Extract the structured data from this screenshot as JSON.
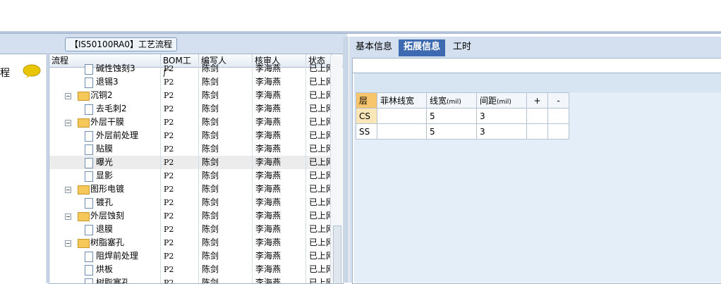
{
  "left_nav": {
    "label": "程"
  },
  "panel_title": "【IS50100RA0】工艺流程",
  "grid": {
    "columns": [
      "流程",
      "BOM工厂",
      "编写人",
      "核审人",
      "状态"
    ],
    "rows": [
      {
        "name": "碱性蚀刻3",
        "type": "doc",
        "indent": 1,
        "bom": "P2",
        "writer": "陈剑",
        "reviewer": "李海燕",
        "status": "已上网"
      },
      {
        "name": "退锡3",
        "type": "doc",
        "indent": 1,
        "bom": "P2",
        "writer": "陈剑",
        "reviewer": "李海燕",
        "status": "已上网"
      },
      {
        "name": "沉铜2",
        "type": "folder",
        "indent": 0,
        "bom": "P2",
        "writer": "陈剑",
        "reviewer": "李海燕",
        "status": "已上网"
      },
      {
        "name": "去毛刺2",
        "type": "doc",
        "indent": 1,
        "bom": "P2",
        "writer": "陈剑",
        "reviewer": "李海燕",
        "status": "已上网"
      },
      {
        "name": "外层干膜",
        "type": "folder",
        "indent": 0,
        "bom": "P2",
        "writer": "陈剑",
        "reviewer": "李海燕",
        "status": "已上网"
      },
      {
        "name": "外层前处理",
        "type": "doc",
        "indent": 1,
        "bom": "P2",
        "writer": "陈剑",
        "reviewer": "李海燕",
        "status": "已上网"
      },
      {
        "name": "贴膜",
        "type": "doc",
        "indent": 1,
        "bom": "P2",
        "writer": "陈剑",
        "reviewer": "李海燕",
        "status": "已上网"
      },
      {
        "name": "曝光",
        "type": "doc",
        "indent": 1,
        "bom": "P2",
        "writer": "陈剑",
        "reviewer": "李海燕",
        "status": "已上网",
        "selected": true
      },
      {
        "name": "显影",
        "type": "doc",
        "indent": 1,
        "bom": "P2",
        "writer": "陈剑",
        "reviewer": "李海燕",
        "status": "已上网"
      },
      {
        "name": "图形电镀",
        "type": "folder",
        "indent": 0,
        "bom": "P2",
        "writer": "陈剑",
        "reviewer": "李海燕",
        "status": "已上网"
      },
      {
        "name": "镀孔",
        "type": "doc",
        "indent": 1,
        "bom": "P2",
        "writer": "陈剑",
        "reviewer": "李海燕",
        "status": "已上网"
      },
      {
        "name": "外层蚀刻",
        "type": "folder",
        "indent": 0,
        "bom": "P2",
        "writer": "陈剑",
        "reviewer": "李海燕",
        "status": "已上网"
      },
      {
        "name": "退膜",
        "type": "doc",
        "indent": 1,
        "bom": "P2",
        "writer": "陈剑",
        "reviewer": "李海燕",
        "status": "已上网"
      },
      {
        "name": "树脂塞孔",
        "type": "folder",
        "indent": 0,
        "bom": "P2",
        "writer": "陈剑",
        "reviewer": "李海燕",
        "status": "已上网"
      },
      {
        "name": "阻焊前处理",
        "type": "doc",
        "indent": 1,
        "bom": "P2",
        "writer": "陈剑",
        "reviewer": "李海燕",
        "status": "已上网"
      },
      {
        "name": "烘板",
        "type": "doc",
        "indent": 1,
        "bom": "P2",
        "writer": "陈剑",
        "reviewer": "李海燕",
        "status": "已上网"
      },
      {
        "name": "树脂塞孔",
        "type": "doc",
        "indent": 1,
        "bom": "P2",
        "writer": "陈剑",
        "reviewer": "李海燕",
        "status": "已上网"
      }
    ]
  },
  "tabs": [
    {
      "label": "基本信息",
      "active": false
    },
    {
      "label": "拓展信息",
      "active": true
    },
    {
      "label": "工时",
      "active": false
    }
  ],
  "ext_table": {
    "headers": {
      "layer": "层",
      "felin": "菲林线宽",
      "linewidth": "线宽",
      "spacing": "间距",
      "unit": "(mil)",
      "add": "+",
      "remove": "-"
    },
    "rows": [
      {
        "layer": "CS",
        "felin": "",
        "linewidth": "5",
        "spacing": "3"
      },
      {
        "layer": "SS",
        "felin": "",
        "linewidth": "5",
        "spacing": "3"
      }
    ]
  },
  "colors": {
    "accent_tab": "#3d6ab0",
    "layer_header": "#f7c56b",
    "layer_cell": "#fbe6b8"
  }
}
